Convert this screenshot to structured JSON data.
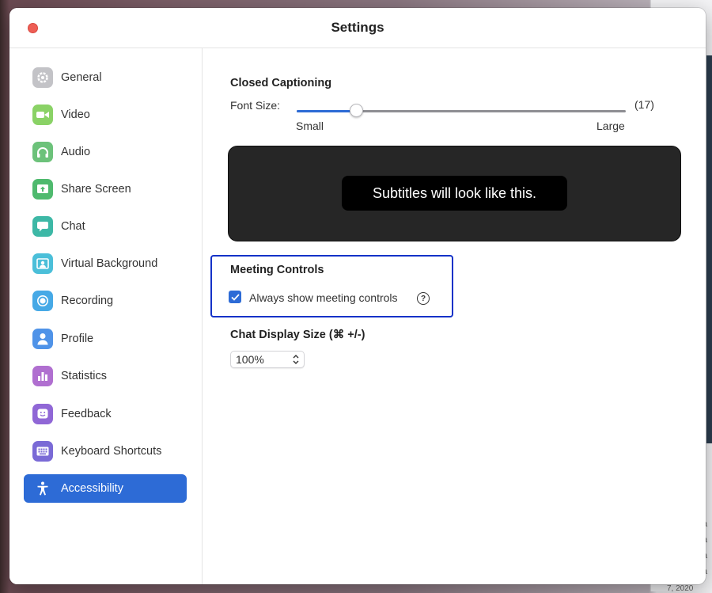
{
  "window": {
    "title": "Settings"
  },
  "sidebar": {
    "items": [
      {
        "label": "General",
        "icon": "gear-icon",
        "color": "#b8b8bc"
      },
      {
        "label": "Video",
        "icon": "video-camera-icon",
        "color": "#7fcf5d"
      },
      {
        "label": "Audio",
        "icon": "headphones-icon",
        "color": "#6cc27a"
      },
      {
        "label": "Share Screen",
        "icon": "share-screen-icon",
        "color": "#4fba6e"
      },
      {
        "label": "Chat",
        "icon": "chat-bubble-icon",
        "color": "#3db8a6"
      },
      {
        "label": "Virtual Background",
        "icon": "person-portrait-icon",
        "color": "#4bbfd9"
      },
      {
        "label": "Recording",
        "icon": "record-icon",
        "color": "#46a9e6"
      },
      {
        "label": "Profile",
        "icon": "user-icon",
        "color": "#4f93e8"
      },
      {
        "label": "Statistics",
        "icon": "bar-chart-icon",
        "color": "#b06fd0"
      },
      {
        "label": "Feedback",
        "icon": "smiley-icon",
        "color": "#9067d6"
      },
      {
        "label": "Keyboard Shortcuts",
        "icon": "keyboard-icon",
        "color": "#7a6ad6"
      },
      {
        "label": "Accessibility",
        "icon": "accessibility-icon",
        "color": "#2d6bd6",
        "active": true
      }
    ]
  },
  "closed_captioning": {
    "title": "Closed Captioning",
    "font_size_label": "Font Size:",
    "value_text": "(17)",
    "min_label": "Small",
    "max_label": "Large",
    "level_fraction": 0.18,
    "preview_text": "Subtitles will look like this."
  },
  "meeting_controls": {
    "title": "Meeting Controls",
    "checkbox_label": "Always show meeting controls",
    "checked": true,
    "help_glyph": "?"
  },
  "chat_display": {
    "title": "Chat Display Size (⌘ +/-)",
    "value": "100%"
  },
  "desktop": {
    "partial_text": "ta",
    "date_fragment": "7, 2020"
  },
  "colors": {
    "accent": "#2d6bd6",
    "highlight": "#1432c8",
    "close": "#ee5e55"
  }
}
